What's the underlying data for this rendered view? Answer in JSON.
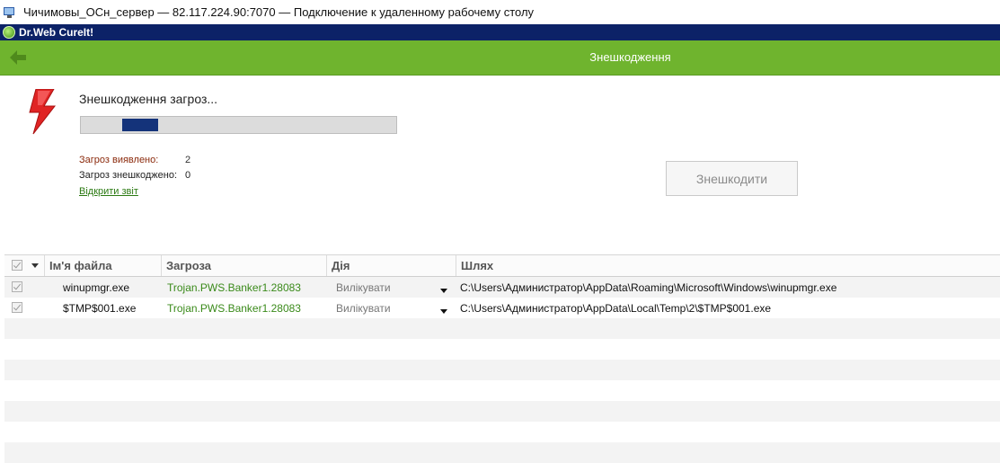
{
  "rdp": {
    "title": "Чичимовы_ОСн_сервер — 82.117.224.90:7070 — Подключение к удаленному рабочему столу"
  },
  "app": {
    "title": "Dr.Web CureIt!"
  },
  "header": {
    "title": "Знешкодження",
    "back_icon": "back-arrow-icon"
  },
  "status": {
    "message": "Знешкодження загроз...",
    "progress": 0.13,
    "found_label": "Загроз виявлено:",
    "found_value": "2",
    "neutralized_label": "Загроз знешкоджено:",
    "neutralized_value": "0",
    "open_report": "Відкрити звіт"
  },
  "actions": {
    "neutralize_label": "Знешкодити"
  },
  "table": {
    "columns": {
      "file": "Ім'я файла",
      "threat": "Загроза",
      "action": "Дія",
      "path": "Шлях"
    },
    "rows": [
      {
        "file": "winupmgr.exe",
        "threat": "Trojan.PWS.Banker1.28083",
        "action": "Вилікувати",
        "path": "C:\\Users\\Администратор\\AppData\\Roaming\\Microsoft\\Windows\\winupmgr.exe"
      },
      {
        "file": "$TMP$001.exe",
        "threat": "Trojan.PWS.Banker1.28083",
        "action": "Вилікувати",
        "path": "C:\\Users\\Администратор\\AppData\\Local\\Temp\\2\\$TMP$001.exe"
      }
    ]
  },
  "colors": {
    "header_green": "#6fb42e",
    "app_title_bg": "#0c2267",
    "progress_fill": "#14337a",
    "threat_text": "#3a8a1a",
    "bolt_red": "#e02424"
  }
}
